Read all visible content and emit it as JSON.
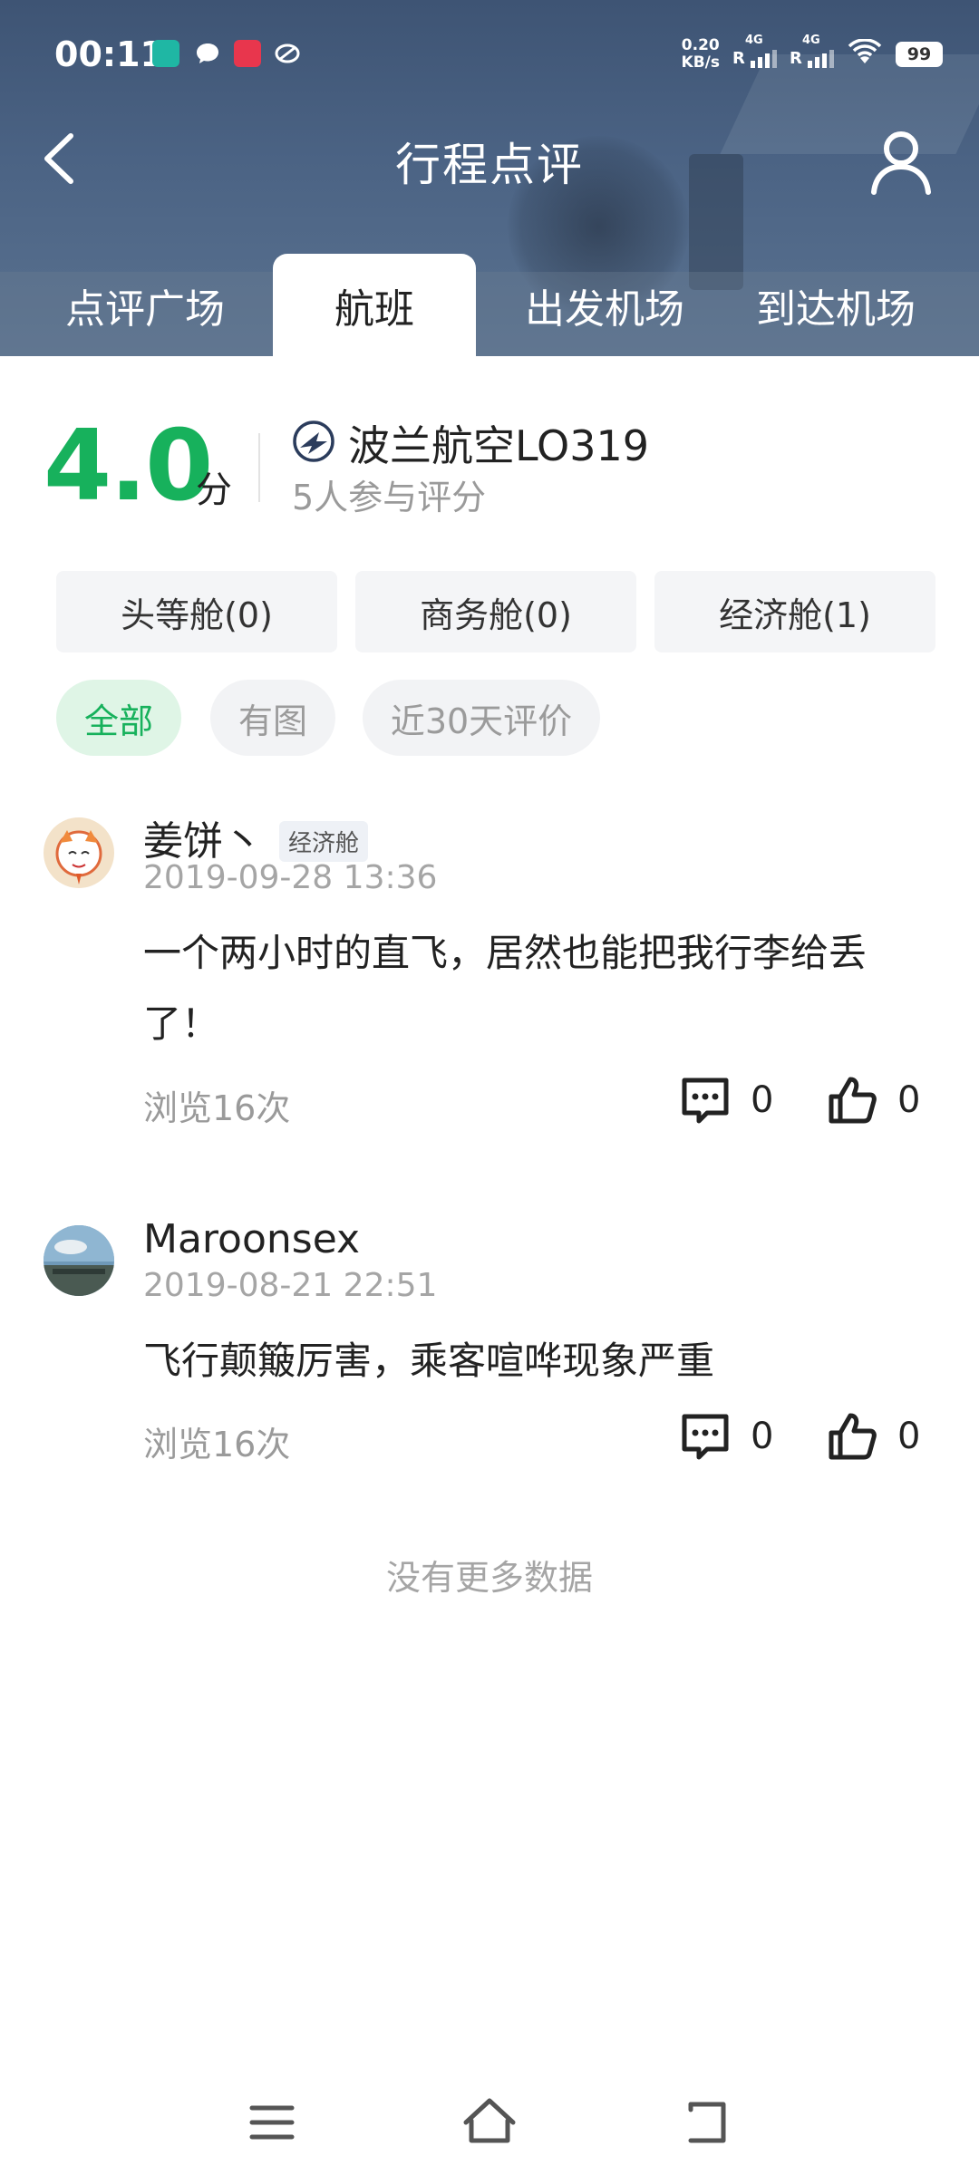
{
  "status_bar": {
    "time": "00:11",
    "net_speed_value": "0.20",
    "net_speed_unit": "KB/s",
    "signal_label": "R",
    "network_type": "4G",
    "battery": "99"
  },
  "header": {
    "title": "行程点评",
    "tabs": [
      {
        "label": "点评广场"
      },
      {
        "label": "航班"
      },
      {
        "label": "出发机场"
      },
      {
        "label": "到达机场"
      }
    ],
    "active_tab": "航班"
  },
  "summary": {
    "score": "4.0",
    "score_unit": "分",
    "flight_name": "波兰航空LO319",
    "raters": "5人参与评分"
  },
  "cabins": [
    {
      "label": "头等舱(0)"
    },
    {
      "label": "商务舱(0)"
    },
    {
      "label": "经济舱(1)"
    }
  ],
  "filters": [
    {
      "label": "全部"
    },
    {
      "label": "有图"
    },
    {
      "label": "近30天评价"
    }
  ],
  "active_filter": "全部",
  "reviews": [
    {
      "user": "姜饼丶",
      "cabin_badge": "经济舱",
      "date": "2019-09-28 13:36",
      "text": "一个两小时的直飞，居然也能把我行李给丢了！",
      "views": "浏览16次",
      "comments": "0",
      "likes": "0"
    },
    {
      "user": "Maroonsex",
      "cabin_badge": "",
      "date": "2019-08-21 22:51",
      "text": "飞行颠簸厉害，乘客喧哗现象严重",
      "views": "浏览16次",
      "comments": "0",
      "likes": "0"
    }
  ],
  "footer_text": "没有更多数据",
  "colors": {
    "accent_green": "#17b15c",
    "header_blue": "#4b6384",
    "chip_active_bg": "#dff5e6"
  }
}
